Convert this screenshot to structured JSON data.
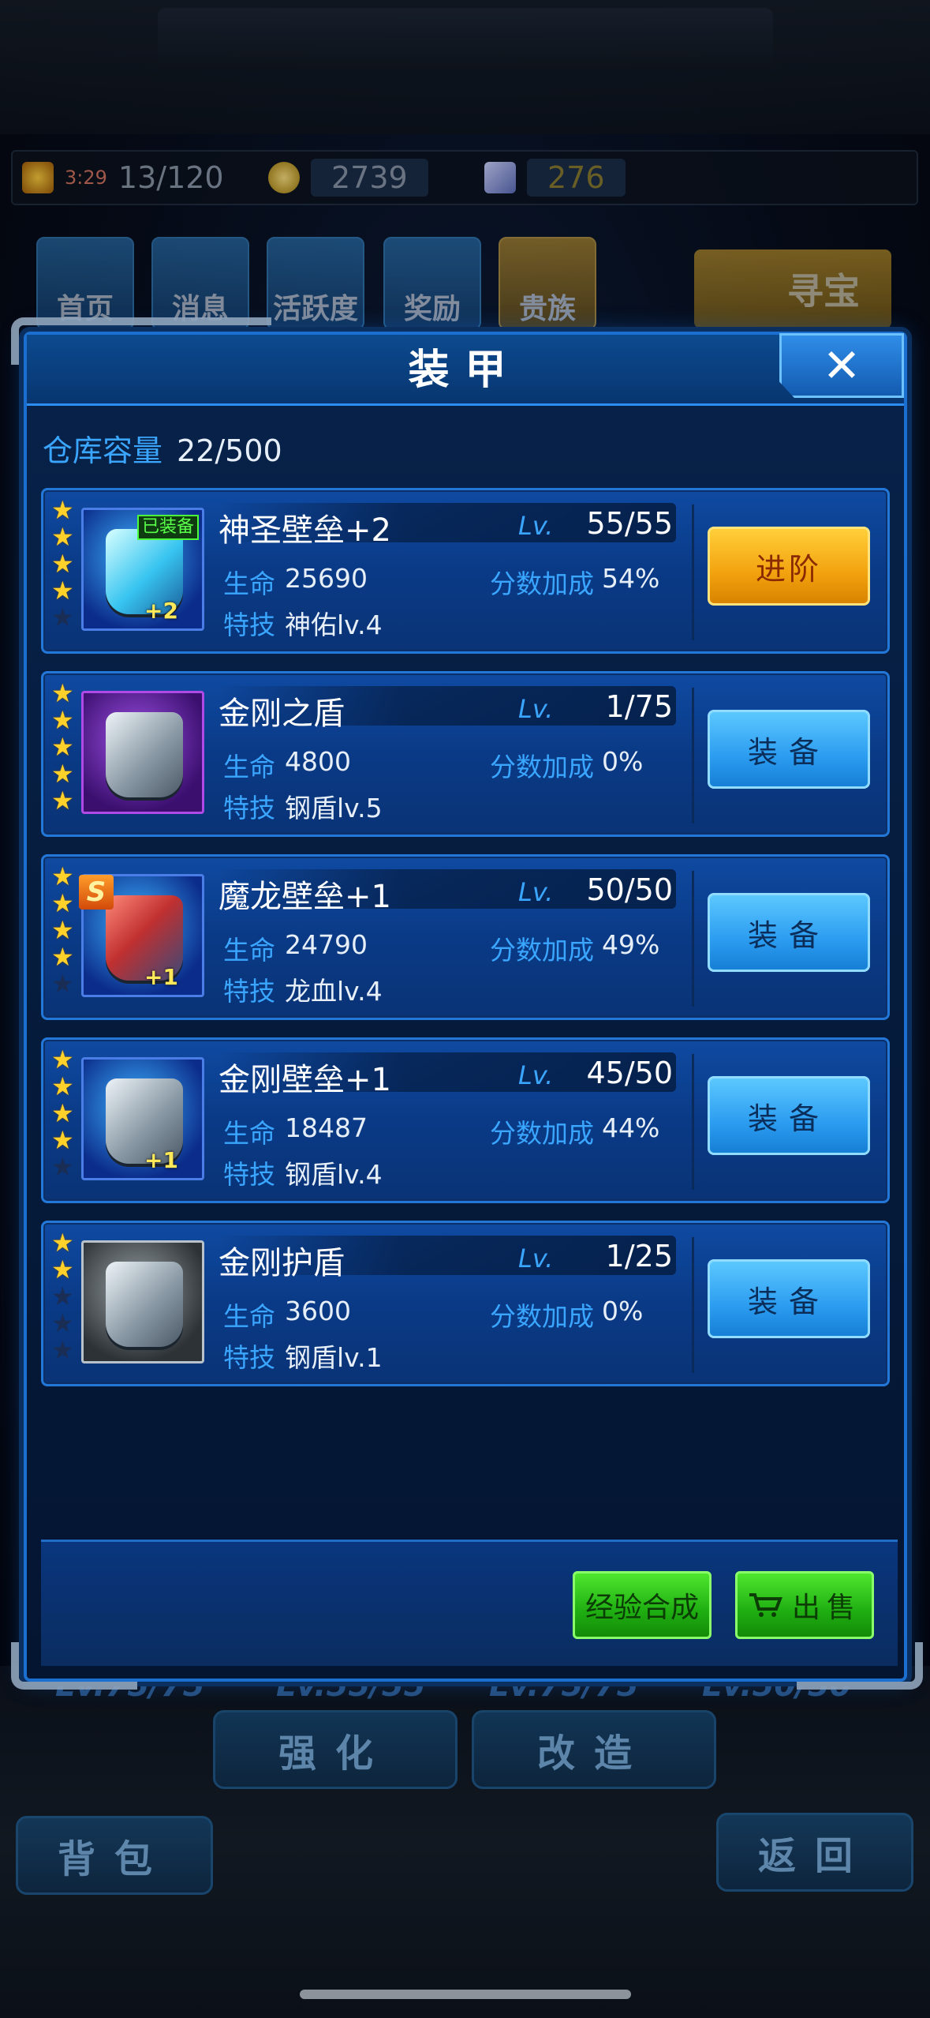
{
  "background": {
    "resources": {
      "energy_timer": "3:29",
      "energy": "13/120",
      "coins": "2739",
      "gems": "276"
    },
    "nav_tiles": [
      "首页",
      "消息",
      "活跃度",
      "奖励",
      "贵族"
    ],
    "treasure_label": "寻宝",
    "levels": [
      "Lv.75/75",
      "Lv.55/55",
      "Lv.75/75",
      "Lv.50/50"
    ],
    "buttons": {
      "strengthen": "强化",
      "modify": "改造",
      "backpack": "背包",
      "back": "返回"
    }
  },
  "dialog": {
    "title": "装甲",
    "close_symbol": "✕",
    "capacity_label": "仓库容量",
    "capacity_value": "22/500",
    "lv_label": "Lv.",
    "hp_label": "生命",
    "score_label": "分数加成",
    "skill_label": "特技",
    "items": [
      {
        "name": "神圣壁垒+2",
        "level": "55/55",
        "hp": "25690",
        "score_bonus": "54%",
        "skill": "神佑lv.4",
        "stars": 4,
        "equipped_badge": "已装备",
        "plus": "+2",
        "action": "进阶"
      },
      {
        "name": "金刚之盾",
        "level": "1/75",
        "hp": "4800",
        "score_bonus": "0%",
        "skill": "钢盾lv.5",
        "stars": 5,
        "action": "装备"
      },
      {
        "name": "魔龙壁垒+1",
        "level": "50/50",
        "hp": "24790",
        "score_bonus": "49%",
        "skill": "龙血lv.4",
        "stars": 4,
        "rank_badge": "S",
        "plus": "+1",
        "action": "装备"
      },
      {
        "name": "金刚壁垒+1",
        "level": "45/50",
        "hp": "18487",
        "score_bonus": "44%",
        "skill": "钢盾lv.4",
        "stars": 4,
        "plus": "+1",
        "action": "装备"
      },
      {
        "name": "金刚护盾",
        "level": "1/25",
        "hp": "3600",
        "score_bonus": "0%",
        "skill": "钢盾lv.1",
        "stars": 2,
        "action": "装备"
      }
    ],
    "footer": {
      "merge_label": "经验合成",
      "sell_label": "出售"
    }
  },
  "colors": {
    "accent_blue": "#3aa6ff",
    "star_gold": "#ffd12a",
    "equip_green": "#59ff4a",
    "upgrade_gold": "#f2a20e"
  }
}
